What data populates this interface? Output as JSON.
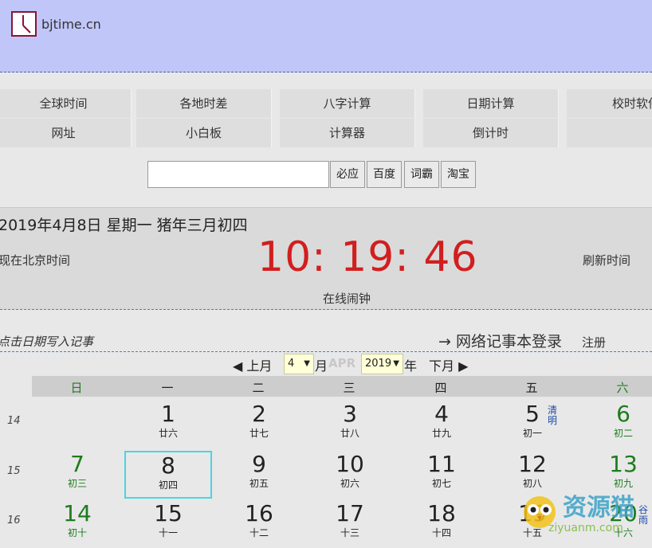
{
  "site": {
    "name": "bjtime.cn"
  },
  "nav": {
    "row1": [
      "全球时间",
      "各地时差",
      "八字计算",
      "日期计算",
      "校时软件"
    ],
    "row2": [
      "网址",
      "小白板",
      "计算器",
      "倒计时",
      ""
    ]
  },
  "search": {
    "value": "",
    "buttons": [
      "必应",
      "百度",
      "词霸",
      "淘宝"
    ]
  },
  "time": {
    "date_line": "2019年4月8日 星期一  猪年三月初四",
    "beijing_label": "现在北京时间",
    "clock": "10: 19: 46",
    "refresh": "刷新时间",
    "alarm": "在线闹钟"
  },
  "memo": {
    "hint": "点击日期写入记事",
    "login": "→ 网络记事本登录",
    "register": "注册"
  },
  "month_bar": {
    "prev": "◀ 上月",
    "month_value": "4",
    "month_unit": "月",
    "month_en": "APR",
    "year_value": "2019",
    "year_unit": "年",
    "next": "下月 ▶"
  },
  "weekdays": [
    "日",
    "一",
    "二",
    "三",
    "四",
    "五",
    "六"
  ],
  "calendar": {
    "weeks": [
      {
        "num": "14",
        "days": [
          {
            "d": "",
            "l": ""
          },
          {
            "d": "1",
            "l": "廿六"
          },
          {
            "d": "2",
            "l": "廿七"
          },
          {
            "d": "3",
            "l": "廿八"
          },
          {
            "d": "4",
            "l": "廿九"
          },
          {
            "d": "5",
            "l": "初一",
            "term": "清明"
          },
          {
            "d": "6",
            "l": "初二"
          }
        ]
      },
      {
        "num": "15",
        "days": [
          {
            "d": "7",
            "l": "初三"
          },
          {
            "d": "8",
            "l": "初四",
            "today": true
          },
          {
            "d": "9",
            "l": "初五"
          },
          {
            "d": "10",
            "l": "初六"
          },
          {
            "d": "11",
            "l": "初七"
          },
          {
            "d": "12",
            "l": "初八"
          },
          {
            "d": "13",
            "l": "初九"
          }
        ]
      },
      {
        "num": "16",
        "days": [
          {
            "d": "14",
            "l": "初十"
          },
          {
            "d": "15",
            "l": "十一"
          },
          {
            "d": "16",
            "l": "十二"
          },
          {
            "d": "17",
            "l": "十三"
          },
          {
            "d": "18",
            "l": "十四"
          },
          {
            "d": "19",
            "l": "十五"
          },
          {
            "d": "20",
            "l": "十六",
            "term": "谷雨"
          }
        ]
      }
    ]
  },
  "watermark": {
    "text": "资源猫",
    "url": "ziyuanm.com"
  },
  "colors": {
    "header": "#c0c6f8",
    "clock": "#d21e1e",
    "weekend": "#1d7c1d",
    "today_border": "#4ad6e0"
  }
}
